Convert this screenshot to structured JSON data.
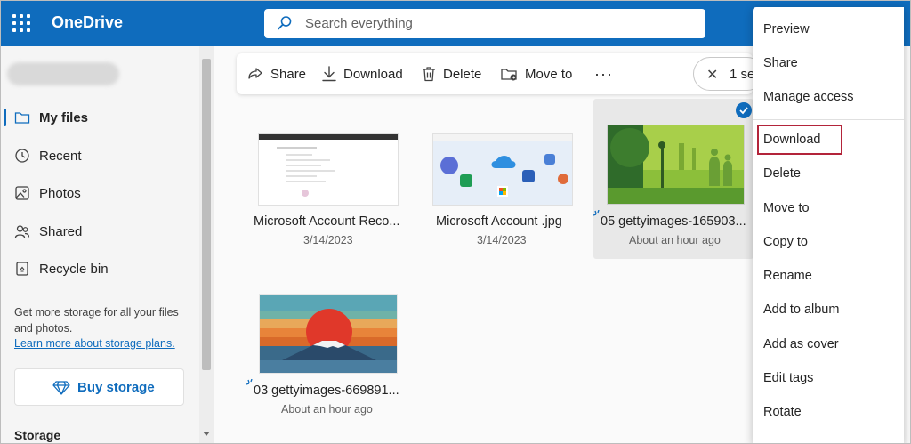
{
  "header": {
    "app_title": "OneDrive",
    "search_placeholder": "Search everything"
  },
  "sidebar": {
    "items": [
      {
        "label": "My files",
        "icon": "folder-icon",
        "active": true
      },
      {
        "label": "Recent",
        "icon": "clock-icon",
        "active": false
      },
      {
        "label": "Photos",
        "icon": "photo-icon",
        "active": false
      },
      {
        "label": "Shared",
        "icon": "people-icon",
        "active": false
      },
      {
        "label": "Recycle bin",
        "icon": "recycle-bin-icon",
        "active": false
      }
    ],
    "promo_text": "Get more storage for all your files and photos.",
    "promo_link": "Learn more about storage plans.",
    "buy_storage": "Buy storage",
    "storage_heading": "Storage"
  },
  "toolbar": {
    "share": "Share",
    "download": "Download",
    "delete": "Delete",
    "move_to": "Move to",
    "more": "···",
    "selection_close": "✕",
    "selection_count": "1 se"
  },
  "files": [
    {
      "name": "Microsoft Account Reco...",
      "date": "3/14/2023"
    },
    {
      "name": "Microsoft Account .jpg",
      "date": "3/14/2023"
    },
    {
      "name": "05 gettyimages-165903...",
      "date": "About an hour ago"
    },
    {
      "name": "03 gettyimages-669891...",
      "date": "About an hour ago"
    }
  ],
  "context_menu": {
    "items": [
      "Preview",
      "Share",
      "Manage access",
      "Download",
      "Delete",
      "Move to",
      "Copy to",
      "Rename",
      "Add to album",
      "Add as cover",
      "Edit tags",
      "Rotate"
    ],
    "highlighted": "Download"
  },
  "colors": {
    "brand": "#0f6cbd",
    "highlight_border": "#b3243a"
  }
}
